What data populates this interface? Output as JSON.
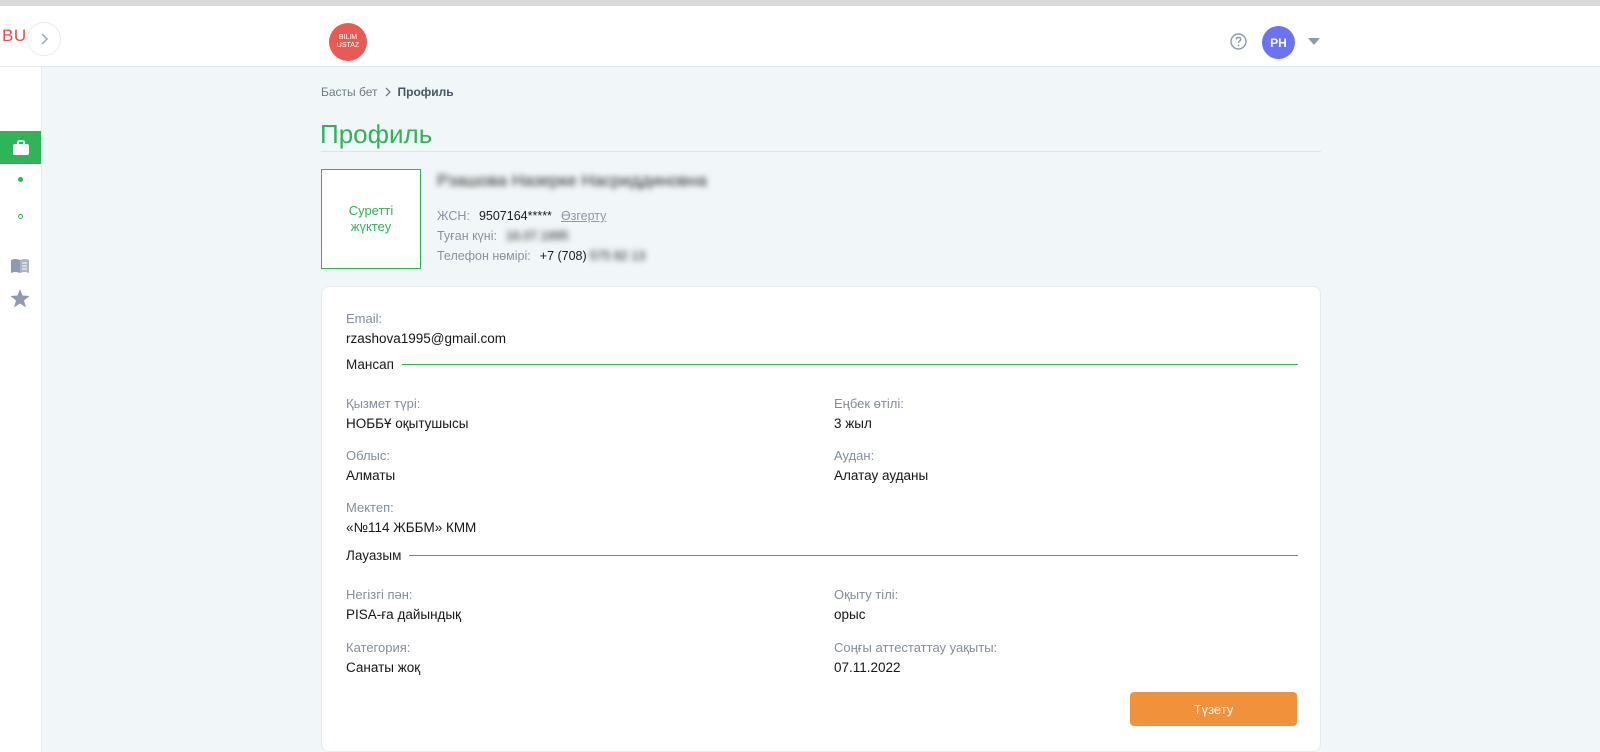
{
  "header": {
    "brand_short": "BU",
    "logo_line1": "BILIM",
    "logo_line2": "USTAZ",
    "avatar_initials": "PH"
  },
  "sidebar": {
    "items": [
      {
        "icon": "briefcase-icon",
        "active": true
      },
      {
        "icon": "dot-icon"
      },
      {
        "icon": "circle-icon"
      },
      {
        "icon": "book-icon"
      },
      {
        "icon": "star-icon"
      }
    ]
  },
  "breadcrumb": {
    "home": "Басты бет",
    "current": "Профиль"
  },
  "page": {
    "title": "Профиль"
  },
  "profile": {
    "photo_upload": "Суретті жүктеу",
    "full_name": "Рзашова Назерке Насриддиновна",
    "iin_label": "ЖСН:",
    "iin_value": "9507164*****",
    "change_link": "Өзгерту",
    "birth_label": "Туған күні:",
    "birth_value": "16.07.1995",
    "phone_label": "Телефон нөмірі:",
    "phone_prefix": "+7 (708)",
    "phone_rest": "575 82 13"
  },
  "card": {
    "email_label": "Email:",
    "email_value": "rzashova1995@gmail.com",
    "career_section": "Мансап",
    "service_type_label": "Қызмет түрі:",
    "service_type_value": "НОББҰ оқытушысы",
    "experience_label": "Еңбек өтілі:",
    "experience_value": "3 жыл",
    "region_label": "Облыс:",
    "region_value": "Алматы",
    "district_label": "Аудан:",
    "district_value": "Алатау ауданы",
    "school_label": "Мектеп:",
    "school_value": "«№114 ЖББМ» КММ",
    "position_section": "Лауазым",
    "subject_label": "Негізгі пән:",
    "subject_value": "PISA-ға дайындық",
    "language_label": "Оқыту тілі:",
    "language_value": "орыс",
    "category_label": "Категория:",
    "category_value": "Санаты жоқ",
    "attestation_label": "Соңғы аттестаттау уақыты:",
    "attestation_value": "07.11.2022",
    "edit_button": "Түзету"
  },
  "colors": {
    "accent_green": "#2fb457",
    "button_orange": "#f2913b",
    "avatar_purple": "#6c73f0",
    "logo_red": "#ea5a52"
  }
}
